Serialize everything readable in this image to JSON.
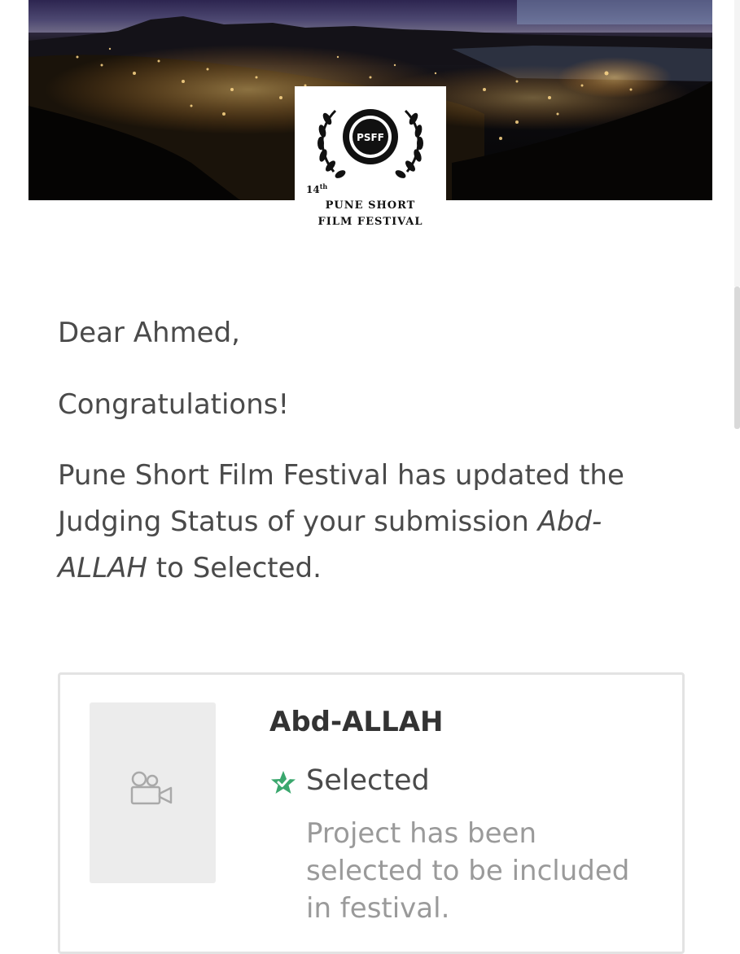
{
  "header": {
    "logo": {
      "badge": "PSFF",
      "edition": "14",
      "edition_suffix": "th",
      "line1": "PUNE SHORT",
      "line2": "FILM FESTIVAL"
    }
  },
  "message": {
    "greeting": "Dear Ahmed,",
    "congrats": "Congratulations!",
    "body_before": "Pune Short Film Festival has updated the Judging Status of your submission ",
    "body_title": "Abd-ALLAH",
    "body_after": " to Selected."
  },
  "submission": {
    "title": "Abd-ALLAH",
    "thumbnail_icon": "video-camera-icon",
    "status": {
      "icon": "star-badge-icon",
      "label": "Selected",
      "description": "Project has been selected to be included in festival.",
      "color": "#3aa76d"
    }
  }
}
